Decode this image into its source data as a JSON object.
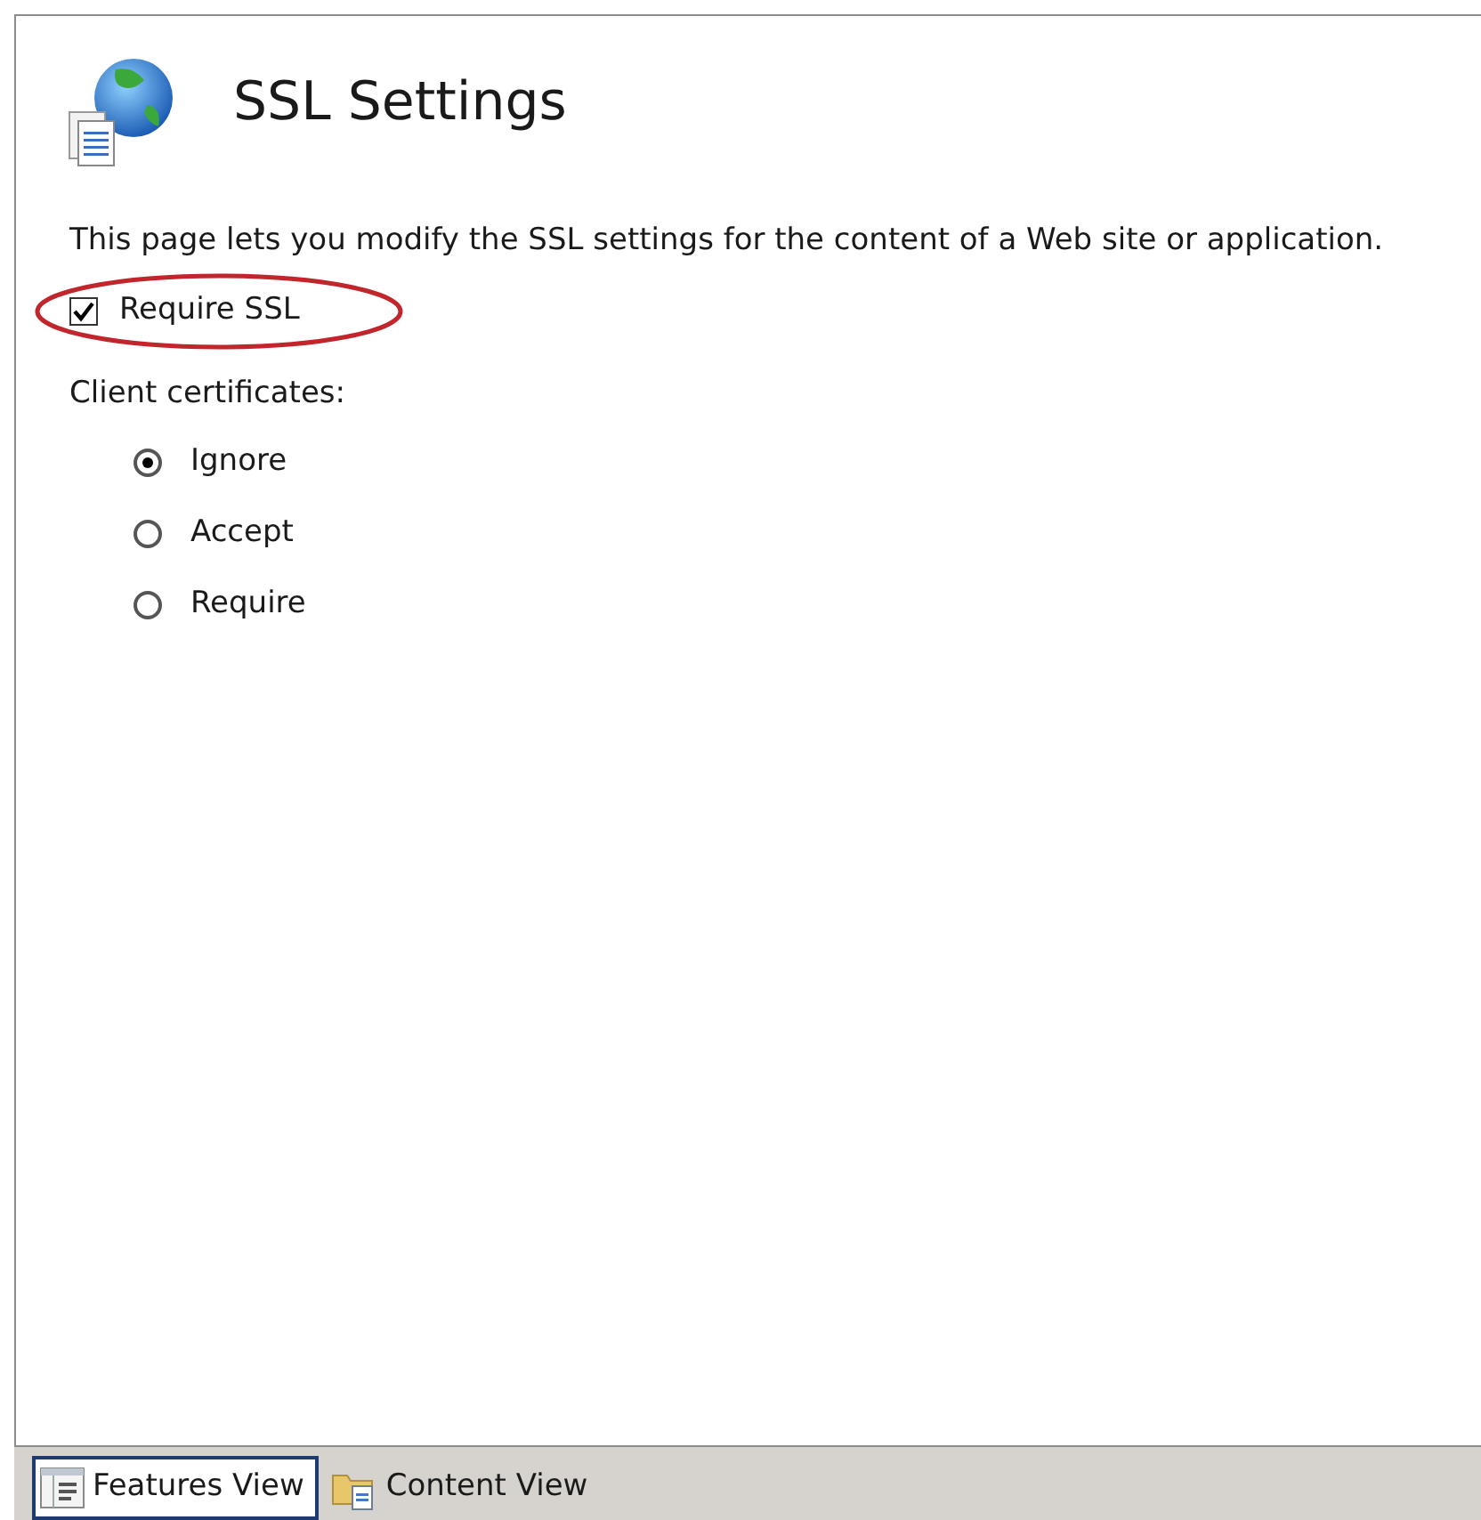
{
  "page": {
    "title": "SSL Settings",
    "description": "This page lets you modify the SSL settings for the content of a Web site or application."
  },
  "require_ssl": {
    "label": "Require SSL",
    "checked": true
  },
  "client_certificates": {
    "label": "Client certificates:",
    "options": [
      {
        "label": "Ignore",
        "selected": true
      },
      {
        "label": "Accept",
        "selected": false
      },
      {
        "label": "Require",
        "selected": false
      }
    ]
  },
  "view_tabs": [
    {
      "label": "Features View",
      "kind": "features",
      "selected": true
    },
    {
      "label": "Content View",
      "kind": "content",
      "selected": false
    }
  ]
}
